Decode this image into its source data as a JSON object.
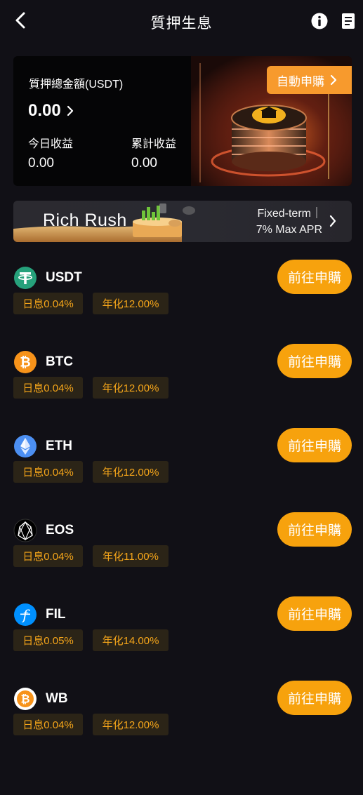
{
  "header": {
    "title": "質押生息"
  },
  "summary": {
    "label": "質押總金額(USDT)",
    "total": "0.00",
    "today_label": "今日收益",
    "today_value": "0.00",
    "cumulative_label": "累計收益",
    "cumulative_value": "0.00",
    "auto_button": "自動申購"
  },
  "banner": {
    "title": "Rich Rush",
    "line1": "Fixed-term｜",
    "line2": "7% Max APR"
  },
  "colors": {
    "background": "#111016",
    "accent": "#f7a20d",
    "tag_background": "#2b2417",
    "tag_text": "#f6a61a"
  },
  "coins": [
    {
      "name": "USDT",
      "icon": "usdt-icon",
      "daily": "日息0.04%",
      "annual": "年化12.00%",
      "button": "前往申購"
    },
    {
      "name": "BTC",
      "icon": "btc-icon",
      "daily": "日息0.04%",
      "annual": "年化12.00%",
      "button": "前往申購"
    },
    {
      "name": "ETH",
      "icon": "eth-icon",
      "daily": "日息0.04%",
      "annual": "年化12.00%",
      "button": "前往申購"
    },
    {
      "name": "EOS",
      "icon": "eos-icon",
      "daily": "日息0.04%",
      "annual": "年化11.00%",
      "button": "前往申購"
    },
    {
      "name": "FIL",
      "icon": "fil-icon",
      "daily": "日息0.05%",
      "annual": "年化14.00%",
      "button": "前往申購"
    },
    {
      "name": "WB",
      "icon": "wb-icon",
      "daily": "日息0.04%",
      "annual": "年化12.00%",
      "button": "前往申購"
    }
  ]
}
